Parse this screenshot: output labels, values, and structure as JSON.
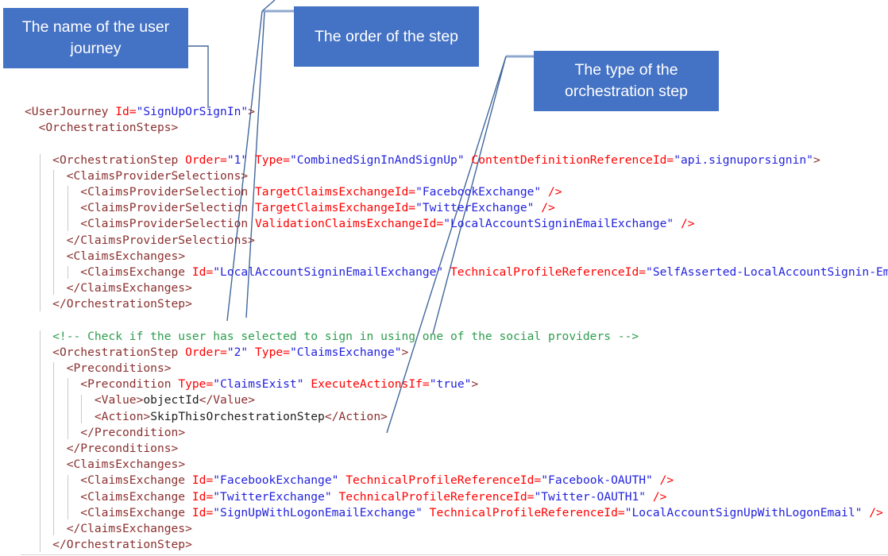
{
  "callouts": [
    {
      "id": "journey",
      "label": "The name of the user journey"
    },
    {
      "id": "order",
      "label": "The order of the step"
    },
    {
      "id": "type",
      "label": "The type of the orchestration step"
    }
  ],
  "colors": {
    "callout_background": "#4472C4",
    "callout_text": "#FFFFFF",
    "leader_line": "#41679B",
    "tag": "#8B2F2F",
    "attribute": "#FF0000",
    "value": "#2222DD",
    "comment": "#2E9D4E",
    "text": "#1F1F1F",
    "indent_guide": "#C9C9C9",
    "page_background": "#FFFFFF"
  },
  "code": {
    "language": "xml",
    "lines": [
      {
        "n": 1,
        "indent": 0,
        "text": "<UserJourney Id=\"SignUpOrSignIn\">"
      },
      {
        "n": 2,
        "indent": 1,
        "text": "<OrchestrationSteps>"
      },
      {
        "n": 3,
        "indent": 0,
        "text": ""
      },
      {
        "n": 4,
        "indent": 2,
        "text": "<OrchestrationStep Order=\"1\" Type=\"CombinedSignInAndSignUp\" ContentDefinitionReferenceId=\"api.signuporsignin\">"
      },
      {
        "n": 5,
        "indent": 3,
        "text": "<ClaimsProviderSelections>"
      },
      {
        "n": 6,
        "indent": 4,
        "text": "<ClaimsProviderSelection TargetClaimsExchangeId=\"FacebookExchange\" />"
      },
      {
        "n": 7,
        "indent": 4,
        "text": "<ClaimsProviderSelection TargetClaimsExchangeId=\"TwitterExchange\" />"
      },
      {
        "n": 8,
        "indent": 4,
        "text": "<ClaimsProviderSelection ValidationClaimsExchangeId=\"LocalAccountSigninEmailExchange\" />"
      },
      {
        "n": 9,
        "indent": 3,
        "text": "</ClaimsProviderSelections>"
      },
      {
        "n": 10,
        "indent": 3,
        "text": "<ClaimsExchanges>"
      },
      {
        "n": 11,
        "indent": 4,
        "text": "<ClaimsExchange Id=\"LocalAccountSigninEmailExchange\" TechnicalProfileReferenceId=\"SelfAsserted-LocalAccountSignin-Email\" />"
      },
      {
        "n": 12,
        "indent": 3,
        "text": "</ClaimsExchanges>"
      },
      {
        "n": 13,
        "indent": 2,
        "text": "</OrchestrationStep>"
      },
      {
        "n": 14,
        "indent": 0,
        "text": ""
      },
      {
        "n": 15,
        "indent": 2,
        "text": "<!-- Check if the user has selected to sign in using one of the social providers -->"
      },
      {
        "n": 16,
        "indent": 2,
        "text": "<OrchestrationStep Order=\"2\" Type=\"ClaimsExchange\">"
      },
      {
        "n": 17,
        "indent": 3,
        "text": "<Preconditions>"
      },
      {
        "n": 18,
        "indent": 4,
        "text": "<Precondition Type=\"ClaimsExist\" ExecuteActionsIf=\"true\">"
      },
      {
        "n": 19,
        "indent": 5,
        "text": "<Value>objectId</Value>"
      },
      {
        "n": 20,
        "indent": 5,
        "text": "<Action>SkipThisOrchestrationStep</Action>"
      },
      {
        "n": 21,
        "indent": 4,
        "text": "</Precondition>"
      },
      {
        "n": 22,
        "indent": 3,
        "text": "</Preconditions>"
      },
      {
        "n": 23,
        "indent": 3,
        "text": "<ClaimsExchanges>"
      },
      {
        "n": 24,
        "indent": 4,
        "text": "<ClaimsExchange Id=\"FacebookExchange\" TechnicalProfileReferenceId=\"Facebook-OAUTH\" />"
      },
      {
        "n": 25,
        "indent": 4,
        "text": "<ClaimsExchange Id=\"TwitterExchange\" TechnicalProfileReferenceId=\"Twitter-OAUTH1\" />"
      },
      {
        "n": 26,
        "indent": 4,
        "text": "<ClaimsExchange Id=\"SignUpWithLogonEmailExchange\" TechnicalProfileReferenceId=\"LocalAccountSignUpWithLogonEmail\" />"
      },
      {
        "n": 27,
        "indent": 3,
        "text": "</ClaimsExchanges>"
      },
      {
        "n": 28,
        "indent": 2,
        "text": "</OrchestrationStep>"
      }
    ]
  }
}
